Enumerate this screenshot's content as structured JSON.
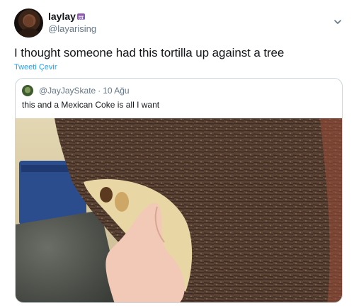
{
  "tweet": {
    "author": {
      "display_name": "laylay",
      "badge": "෭෭෭",
      "handle": "@layarising"
    },
    "text": "I thought someone had this tortilla up against a tree",
    "translate_label": "Tweeti Çevir",
    "menu_icon": "chevron-down-icon"
  },
  "quote": {
    "handle": "@JayJaySkate",
    "separator": "·",
    "date": "10 Ağu",
    "text": "this and a Mexican Coke is all I want"
  },
  "colors": {
    "link": "#1da1f2",
    "secondary_text": "#657786",
    "border": "#ccd6dd"
  }
}
